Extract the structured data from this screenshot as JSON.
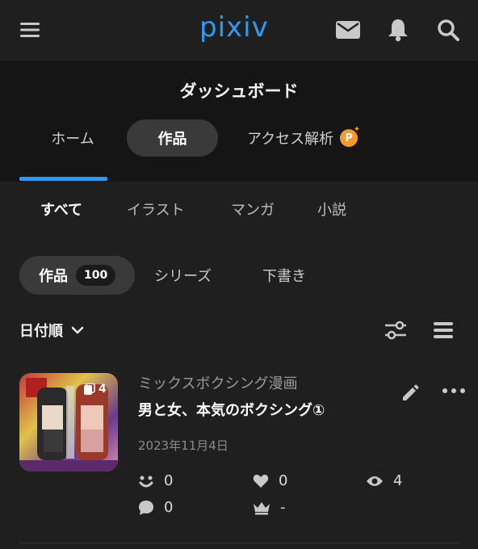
{
  "header": {
    "logo": "pixiv",
    "icons": [
      "menu-icon",
      "mail-icon",
      "bell-icon",
      "search-icon"
    ]
  },
  "dashboard": {
    "title": "ダッシュボード",
    "tabs": [
      {
        "label": "ホーム",
        "active": false
      },
      {
        "label": "作品",
        "active": true
      },
      {
        "label": "アクセス解析",
        "active": false,
        "badge": "P"
      }
    ]
  },
  "filters": [
    {
      "label": "すべて",
      "active": true
    },
    {
      "label": "イラスト",
      "active": false
    },
    {
      "label": "マンガ",
      "active": false
    },
    {
      "label": "小説",
      "active": false
    }
  ],
  "pills": [
    {
      "label": "作品",
      "count": "100",
      "active": true
    },
    {
      "label": "シリーズ",
      "active": false
    },
    {
      "label": "下書き",
      "active": false
    }
  ],
  "sort": {
    "label": "日付順",
    "icons": [
      "filter-sliders-icon",
      "list-view-icon"
    ]
  },
  "work": {
    "series": "ミックスボクシング漫画",
    "title": "男と女、本気のボクシング①",
    "date": "2023年11月4日",
    "page_count": "4",
    "stats": {
      "responses": "0",
      "likes": "0",
      "views": "4",
      "comments": "0",
      "ranking": "-"
    }
  },
  "colors": {
    "accent": "#2f9bf0",
    "background": "#1f1f1f",
    "dashboard_bg": "#151515",
    "premium_badge": "#f39a2b"
  }
}
